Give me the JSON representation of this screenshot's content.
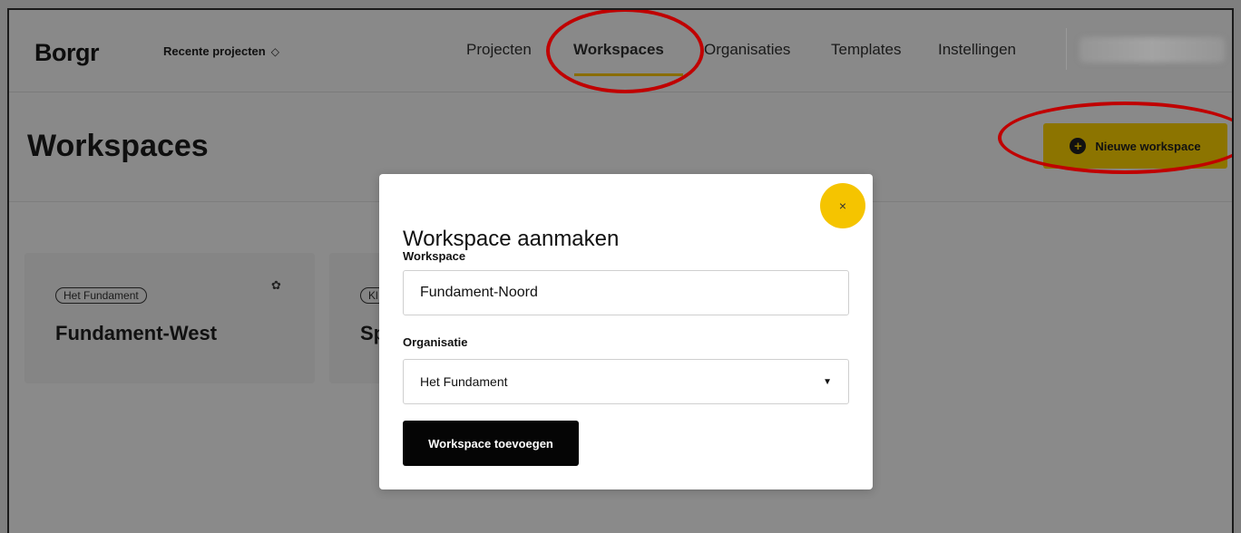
{
  "header": {
    "brand": "Borgr",
    "recent_projects": "Recente projecten",
    "nav": [
      {
        "label": "Projecten"
      },
      {
        "label": "Workspaces"
      },
      {
        "label": "Organisaties"
      },
      {
        "label": "Templates"
      },
      {
        "label": "Instellingen"
      }
    ],
    "active_nav": "Workspaces"
  },
  "page": {
    "title": "Workspaces",
    "new_button_label": "Nieuwe workspace"
  },
  "cards": [
    {
      "tag": "Het Fundament",
      "name": "Fundament-West"
    },
    {
      "tag": "Kl",
      "name": "Sp"
    }
  ],
  "modal": {
    "title": "Workspace aanmaken",
    "close_label": "×",
    "workspace_label": "Workspace",
    "workspace_value": "Fundament-Noord",
    "organisation_label": "Organisatie",
    "organisation_value": "Het Fundament",
    "submit_label": "Workspace toevoegen"
  },
  "colors": {
    "accent": "#f5c400",
    "annotation": "#c00000",
    "overlay": "#898989"
  }
}
